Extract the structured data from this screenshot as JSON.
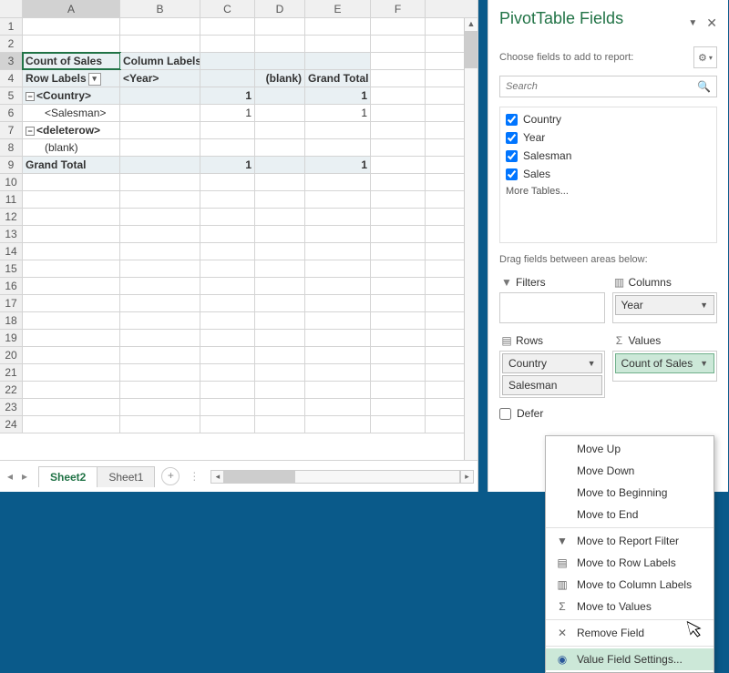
{
  "cols": [
    {
      "l": "A",
      "w": 107
    },
    {
      "l": "B",
      "w": 88
    },
    {
      "l": "C",
      "w": 60
    },
    {
      "l": "D",
      "w": 55
    },
    {
      "l": "E",
      "w": 72
    },
    {
      "l": "F",
      "w": 60
    }
  ],
  "rows": 24,
  "selected_cell": "A3",
  "pivot": {
    "r3": {
      "a": "Count of Sales",
      "b": "Column Labels"
    },
    "r4": {
      "a": "Row Labels",
      "b": "<Year>",
      "d": "(blank)",
      "e": "Grand Total"
    },
    "r5": {
      "a": "<Country>",
      "c": "1",
      "e": "1"
    },
    "r6": {
      "a": "<Salesman>",
      "c": "1",
      "e": "1"
    },
    "r7": {
      "a": "<deleterow>"
    },
    "r8": {
      "a": "(blank)"
    },
    "r9": {
      "a": "Grand Total",
      "c": "1",
      "e": "1"
    }
  },
  "tabs": {
    "active": "Sheet2",
    "other": "Sheet1"
  },
  "pane": {
    "title": "PivotTable Fields",
    "choose": "Choose fields to add to report:",
    "search_placeholder": "Search",
    "fields": [
      "Country",
      "Year",
      "Salesman",
      "Sales"
    ],
    "more": "More Tables...",
    "drag": "Drag fields between areas below:",
    "areas": {
      "filters": {
        "label": "Filters",
        "items": []
      },
      "columns": {
        "label": "Columns",
        "items": [
          "Year"
        ]
      },
      "rows": {
        "label": "Rows",
        "items": [
          "Country",
          "Salesman"
        ]
      },
      "values": {
        "label": "Values",
        "items": [
          "Count of Sales"
        ]
      }
    },
    "defer": "Defer"
  },
  "menu": {
    "moveup": "Move Up",
    "movedown": "Move Down",
    "movebeg": "Move to Beginning",
    "moveend": "Move to End",
    "toreport": "Move to Report Filter",
    "torow": "Move to Row Labels",
    "tocol": "Move to Column Labels",
    "toval": "Move to Values",
    "remove": "Remove Field",
    "vfs": "Value Field Settings..."
  }
}
